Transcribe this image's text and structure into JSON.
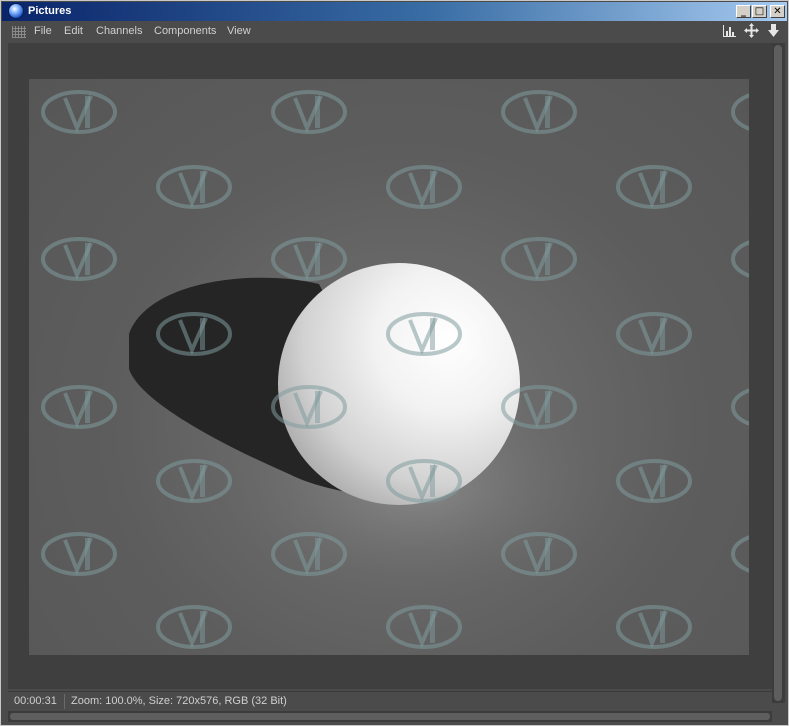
{
  "window": {
    "title": "Pictures"
  },
  "window_controls": {
    "minimize_glyph": "_",
    "maximize_glyph": "□",
    "close_glyph": "✕"
  },
  "menu": {
    "items": [
      "File",
      "Edit",
      "Channels",
      "Components",
      "View"
    ]
  },
  "toolbar": {
    "icons": [
      "histogram-icon",
      "move-icon",
      "download-arrow-icon"
    ]
  },
  "status": {
    "time": "00:00:31",
    "info": "Zoom: 100.0%, Size: 720x576, RGB (32 Bit)"
  },
  "colors": {
    "titlebar_start": "#0a246a",
    "titlebar_end": "#a6caf0",
    "panel": "#4b4b4b",
    "render_bg": "#5d5d5d",
    "watermark": "#7f9a9c"
  }
}
